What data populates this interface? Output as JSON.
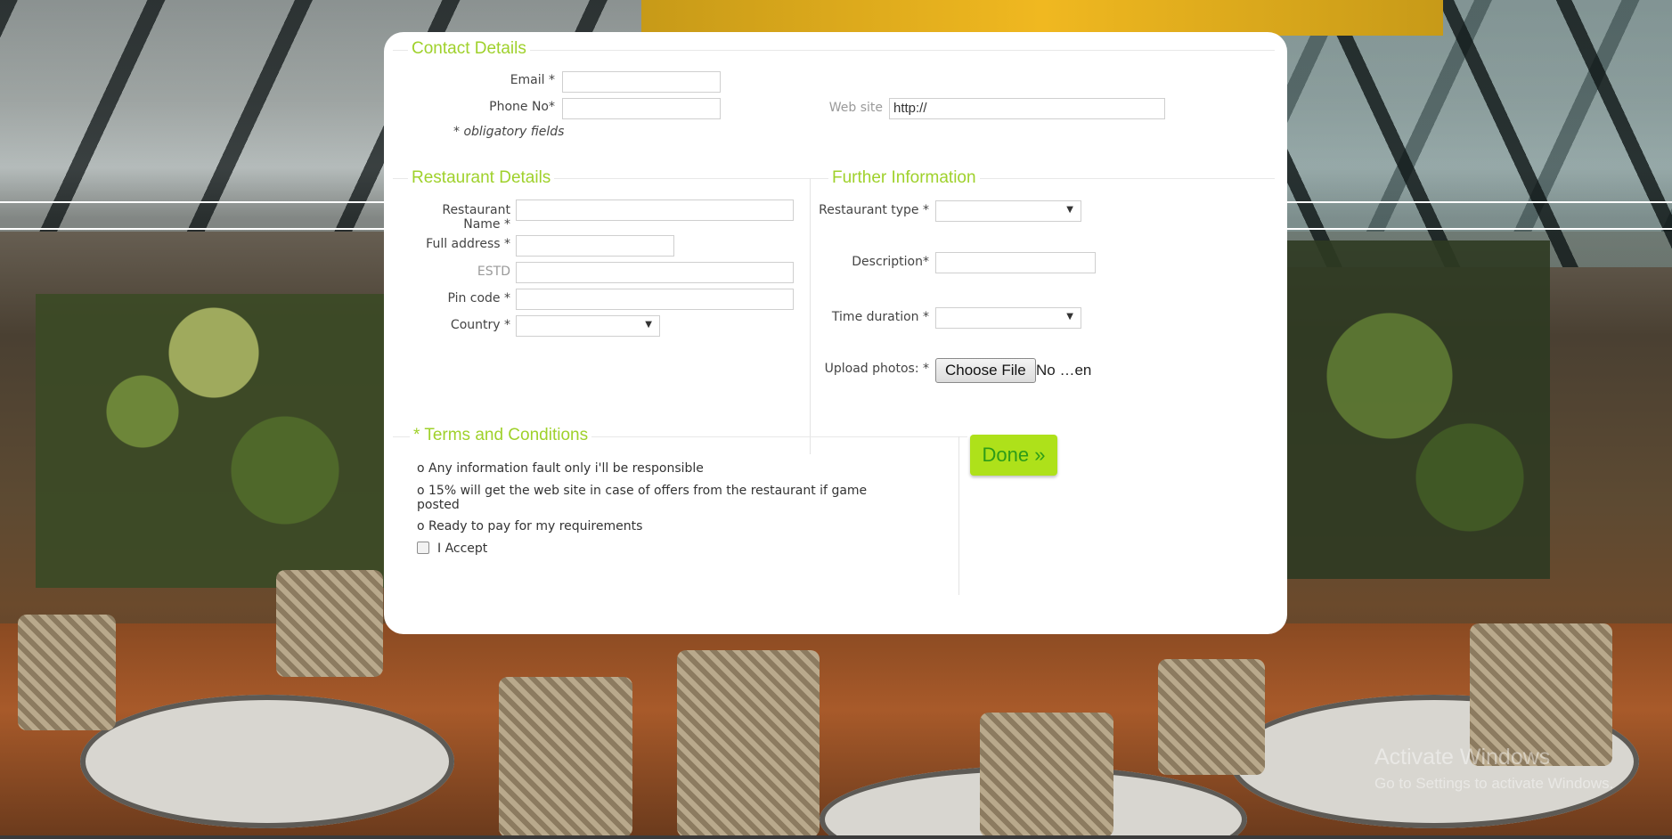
{
  "contact": {
    "title": "Contact Details",
    "email_label": "Email *",
    "email_value": "",
    "phone_label": "Phone No*",
    "phone_value": "",
    "website_label": "Web site",
    "website_value": "http://",
    "obligatory_note": "* obligatory fields"
  },
  "restaurant": {
    "title": "Restaurant Details",
    "name_label": "Restaurant Name *",
    "address_label": "Full address *",
    "estd_label": "ESTD",
    "pin_label": "Pin code *",
    "country_label": "Country *",
    "country_value": ""
  },
  "further": {
    "title": "Further Information",
    "type_label": "Restaurant type *",
    "type_value": "",
    "description_label": "Description*",
    "duration_label": "Time duration *",
    "duration_value": "",
    "upload_label": "Upload photos: *",
    "choose_file_label": "Choose File",
    "file_status": "No …en"
  },
  "terms": {
    "title": "* Terms and Conditions",
    "items": [
      "o Any information fault only i'll be responsible",
      "o 15% will get the web site in case of offers from the restaurant if game posted",
      "o Ready to pay for my requirements"
    ],
    "accept_label": "I Accept",
    "accept_checked": false
  },
  "done_label": "Done »",
  "watermark": {
    "title": "Activate Windows",
    "subtitle": "Go to Settings to activate Windows."
  },
  "colors": {
    "accent": "#9fd12b",
    "button": "#aee11a",
    "button_text": "#2d9c18"
  }
}
